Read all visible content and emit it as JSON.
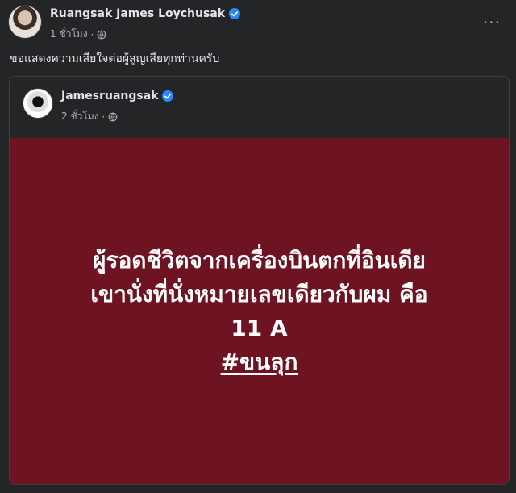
{
  "post": {
    "author": "Ruangsak James Loychusak",
    "time": "1 ชั่วโมง",
    "separator": "·",
    "caption": "ขอแสดงความเสียใจต่อผู้สูญเสียทุกท่านครับ",
    "more_icon": "more-horizontal-icon",
    "more_label": "···"
  },
  "shared_post": {
    "author": "Jamesruangsak",
    "time": "2 ชั่วโมง",
    "separator": "·",
    "panel": {
      "line1": "ผู้รอดชีวิตจากเครื่องบินตกที่อินเดีย",
      "line2": "เขานั่งที่นั่งหมายเลขเดียวกับผม คือ",
      "line3": "11 A",
      "hashtag": "#ขนลุก",
      "background": "#6d1322"
    }
  },
  "colors": {
    "background": "#242526",
    "text_primary": "#e4e6eb",
    "text_secondary": "#b0b3b8",
    "verified_badge": "#2d88ff"
  }
}
